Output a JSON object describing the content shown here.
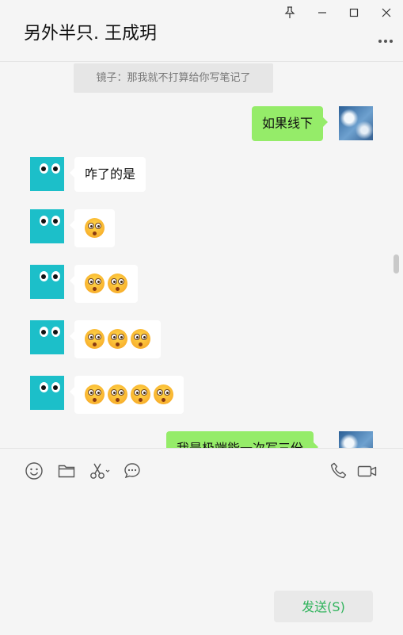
{
  "chat": {
    "title": "另外半只. 王成玥",
    "quoted_message": "镜子：那我就不打算给你写笔记了",
    "messages": [
      {
        "side": "me",
        "type": "text",
        "text": "如果线下"
      },
      {
        "side": "other",
        "type": "text",
        "text": "咋了的是"
      },
      {
        "side": "other",
        "type": "emoji",
        "count": 1,
        "emoji": "flushed-face"
      },
      {
        "side": "other",
        "type": "emoji",
        "count": 2,
        "emoji": "flushed-face"
      },
      {
        "side": "other",
        "type": "emoji",
        "count": 3,
        "emoji": "flushed-face"
      },
      {
        "side": "other",
        "type": "emoji",
        "count": 4,
        "emoji": "flushed-face"
      },
      {
        "side": "me",
        "type": "text",
        "text": "我是极端能一次写三份"
      }
    ]
  },
  "window_controls": [
    "pin-icon",
    "minimize-icon",
    "maximize-icon",
    "close-icon"
  ],
  "toolbar": {
    "left_icons": [
      "emoji-icon",
      "folder-icon",
      "scissors-icon",
      "chat-history-icon"
    ],
    "right_icons": [
      "phone-icon",
      "video-icon"
    ],
    "send_label": "发送(S)"
  },
  "colors": {
    "background": "#f5f5f5",
    "bubble_out": "#95ec69",
    "bubble_in": "#ffffff",
    "avatar_other": "#1cbfc9",
    "send_text": "#2fb35b"
  }
}
